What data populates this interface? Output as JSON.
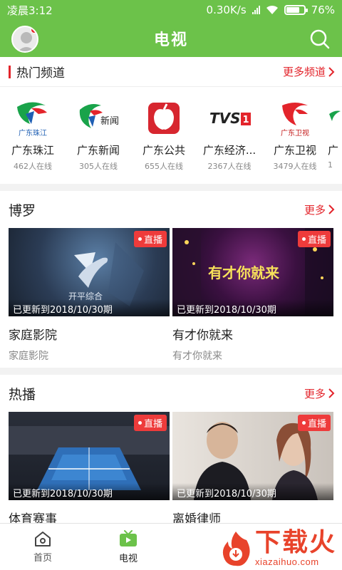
{
  "status_bar": {
    "time": "凌晨3:12",
    "speed": "0.30K/s",
    "battery": "76%"
  },
  "header": {
    "title": "电视"
  },
  "hot_channels": {
    "title": "热门频道",
    "more": "更多频道",
    "items": [
      {
        "name": "广东珠江",
        "online": "462人在线",
        "logo_text": "广东珠江"
      },
      {
        "name": "广东新闻",
        "online": "305人在线",
        "logo_text": "新闻"
      },
      {
        "name": "广东公共",
        "online": "655人在线",
        "logo_text": ""
      },
      {
        "name": "广东经济...",
        "online": "2367人在线",
        "logo_text": "TVS"
      },
      {
        "name": "广东卫视",
        "online": "3479人在线",
        "logo_text": "广东卫视"
      },
      {
        "name": "广",
        "online": "1",
        "logo_text": ""
      }
    ]
  },
  "boluo": {
    "title": "博罗",
    "more": "更多",
    "cards": [
      {
        "live": "直播",
        "updated": "已更新到2018/10/30期",
        "title": "家庭影院",
        "subtitle": "家庭影院",
        "thumb_text": "开平综合"
      },
      {
        "live": "直播",
        "updated": "已更新到2018/10/30期",
        "title": "有才你就来",
        "subtitle": "有才你就来",
        "thumb_text": "有才你就来"
      }
    ]
  },
  "hot": {
    "title": "热播",
    "more": "更多",
    "cards": [
      {
        "live": "直播",
        "updated": "已更新到2018/10/30期",
        "title": "体育赛事"
      },
      {
        "live": "直播",
        "updated": "已更新到2018/10/30期",
        "title": "离婚律师"
      }
    ]
  },
  "bottom_nav": {
    "items": [
      {
        "label": "首页",
        "icon": "home-icon"
      },
      {
        "label": "电视",
        "icon": "tv-icon"
      }
    ]
  },
  "watermark": {
    "text": "下载火",
    "url": "xiazaihuo.com"
  },
  "colors": {
    "brand_green": "#6cc24a",
    "accent_red": "#e3242b",
    "live_red": "#ee3b3b"
  }
}
